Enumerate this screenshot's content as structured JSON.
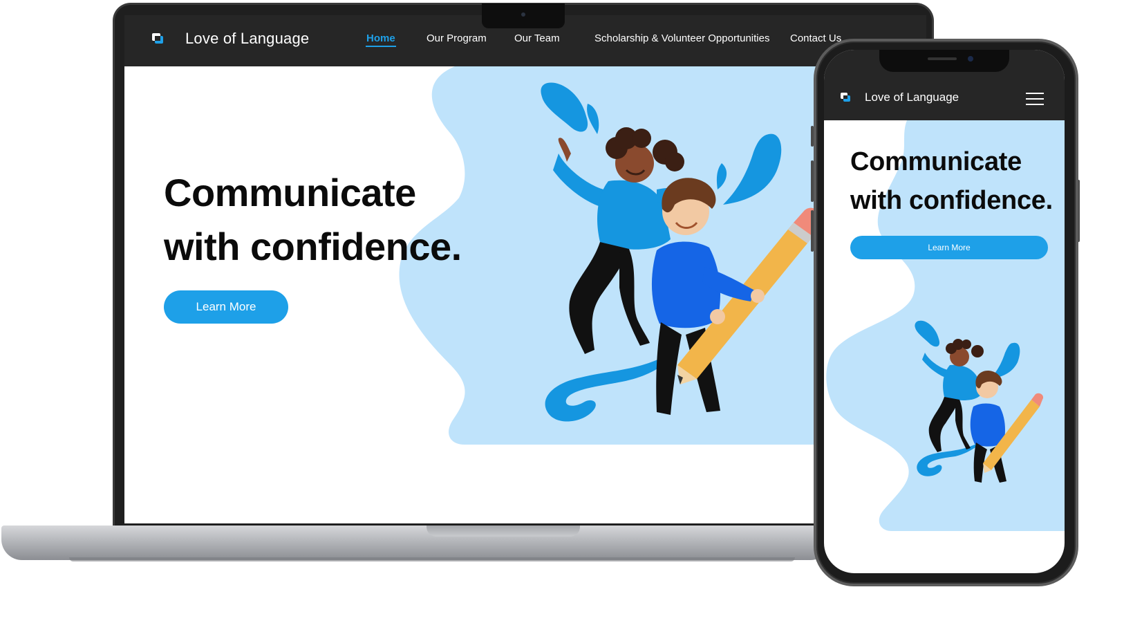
{
  "site": {
    "brand": "Love of Language",
    "accent_color": "#1ea0e8",
    "nav_color": "#262626",
    "blob_color": "#bfe3fb"
  },
  "desktop": {
    "nav": {
      "links": [
        {
          "label": "Home",
          "active": true
        },
        {
          "label": "Our Program",
          "active": false
        },
        {
          "label": "Our Team",
          "active": false
        },
        {
          "label": "Scholarship & Volunteer Opportunities",
          "active": false
        },
        {
          "label": "Contact Us",
          "active": false
        }
      ]
    },
    "hero": {
      "heading_line1": "Communicate",
      "heading_line2": "with confidence.",
      "cta_label": "Learn More"
    }
  },
  "mobile": {
    "menu_icon": "hamburger-icon",
    "hero": {
      "heading_line1": "Communicate",
      "heading_line2": "with confidence.",
      "cta_label": "Learn More"
    }
  },
  "illustration": "two-kids-with-giant-pencil"
}
